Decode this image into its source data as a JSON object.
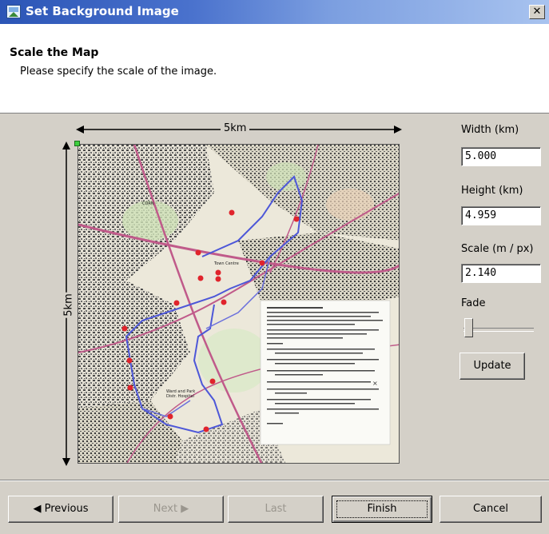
{
  "window": {
    "title": "Set Background Image",
    "close_glyph": "✕"
  },
  "header": {
    "title": "Scale the Map",
    "subtitle": "Please specify the scale of the image."
  },
  "map": {
    "width_label": "5km",
    "height_label": "5km"
  },
  "fields": {
    "width_label": "Width (km)",
    "width_value": "5.000",
    "height_label": "Height (km)",
    "height_value": "4.959",
    "scale_label": "Scale (m / px)",
    "scale_value": "2.140",
    "fade_label": "Fade",
    "fade_value": 0.0
  },
  "buttons": {
    "update": "Update",
    "previous": "◀ Previous",
    "next": "Next ▶",
    "last": "Last",
    "finish": "Finish",
    "cancel": "Cancel"
  },
  "icons": {
    "window_icon": "image-icon",
    "close": "close-icon"
  }
}
